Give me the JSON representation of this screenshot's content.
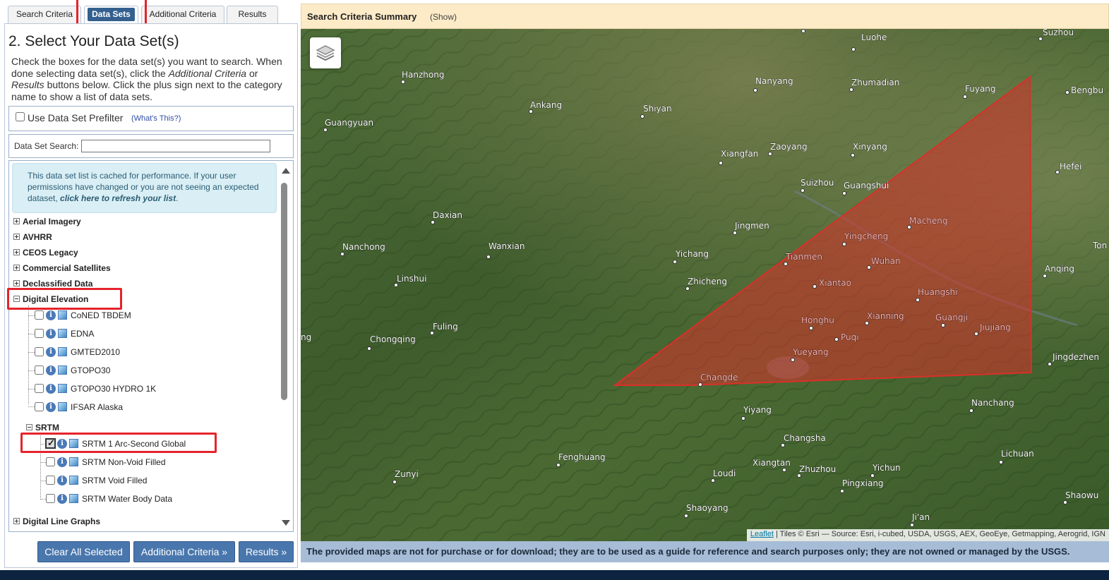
{
  "tabs": [
    {
      "label": "Search Criteria"
    },
    {
      "label": "Data Sets"
    },
    {
      "label": "Additional Criteria"
    },
    {
      "label": "Results"
    }
  ],
  "section_title": "2. Select Your Data Set(s)",
  "intro": {
    "part1": "Check the boxes for the data set(s) you want to search. When done selecting data set(s), click the ",
    "em1": "Additional Criteria",
    "part2": " or ",
    "em2": "Results",
    "part3": " buttons below. Click the plus sign next to the category name to show a list of data sets."
  },
  "prefilter": {
    "label": "Use Data Set Prefilter",
    "help": "(What's This?)"
  },
  "search": {
    "label": "Data Set Search:",
    "value": ""
  },
  "notice": {
    "text": "This data set list is cached for performance. If your user permissions have changed or you are not seeing an expected dataset, ",
    "link": "click here to refresh your list",
    "end": "."
  },
  "categories": {
    "aerial": "Aerial Imagery",
    "avhrr": "AVHRR",
    "ceos": "CEOS Legacy",
    "commercial": "Commercial Satellites",
    "declassified": "Declassified Data",
    "digital_elevation": "Digital Elevation",
    "digital_line": "Digital Line Graphs"
  },
  "elevation_datasets": [
    "CoNED TBDEM",
    "EDNA",
    "GMTED2010",
    "GTOPO30",
    "GTOPO30 HYDRO 1K",
    "IFSAR Alaska"
  ],
  "srtm": {
    "label": "SRTM",
    "datasets": [
      "SRTM 1 Arc-Second Global",
      "SRTM Non-Void Filled",
      "SRTM Void Filled",
      "SRTM Water Body Data"
    ],
    "checked_index": 0
  },
  "buttons": {
    "clear": "Clear All Selected",
    "additional": "Additional Criteria »",
    "results": "Results »"
  },
  "summary": {
    "title": "Search Criteria Summary",
    "show": "(Show)"
  },
  "map": {
    "attribution_link": "Leaflet",
    "attribution_text": " | Tiles © Esri — Source: Esri, i-cubed, USDA, USGS, AEX, GeoEye, Getmapping, Aerogrid, IGN",
    "disclaimer": "The provided maps are not for purchase or for download; they are to be used as a guide for reference and search purposes only; they are not owned or managed by the USGS.",
    "polygon_color": "#d9302a",
    "cities": {
      "luohe": "Luohe",
      "suzhou_n": "Suzhou",
      "hanzhong": "Hanzhong",
      "nanyang": "Nanyang",
      "zhumadian": "Zhumadian",
      "fuyang": "Fuyang",
      "bengbu": "Bengbu",
      "ankang": "Ankang",
      "shiyan": "Shiyan",
      "guangyuan": "Guangyuan",
      "xiangfan": "Xiangfan",
      "zaoyang": "Zaoyang",
      "xinyang": "Xinyang",
      "hefei": "Hefei",
      "suizhou": "Suizhou",
      "guangshui": "Guangshui",
      "daxian": "Daxian",
      "jingmen": "Jingmen",
      "macheng": "Macheng",
      "yingcheng": "Yingcheng",
      "nanchong": "Nanchong",
      "wanxian": "Wanxian",
      "yichang": "Yichang",
      "tianmen": "Tianmen",
      "wuhan": "Wuhan",
      "tong": "Ton",
      "anqing": "Anqing",
      "linshui": "Linshui",
      "zhicheng": "Zhicheng",
      "xiantao": "Xiantao",
      "huangshi": "Huangshi",
      "fuling": "Fuling",
      "honghu": "Honghu",
      "xianning": "Xianning",
      "guangji": "Guangji",
      "jiujiang": "Jiujiang",
      "ng": "ng",
      "chongqing": "Chongqing",
      "puqi": "Puqi",
      "yueyang": "Yueyang",
      "jingdezhen": "Jingdezhen",
      "changde": "Changde",
      "yiyang": "Yiyang",
      "nanchang": "Nanchang",
      "changsha": "Changsha",
      "fenghuang": "Fenghuang",
      "lichuan": "Lichuan",
      "zunyi": "Zunyi",
      "xiangtan": "Xiangtan",
      "zhuzhou": "Zhuzhou",
      "yichun": "Yichun",
      "loudi": "Loudi",
      "pingxiang": "Pingxiang",
      "shaowu": "Shaowu",
      "shaoyang": "Shaoyang",
      "jian": "Ji'an"
    }
  }
}
